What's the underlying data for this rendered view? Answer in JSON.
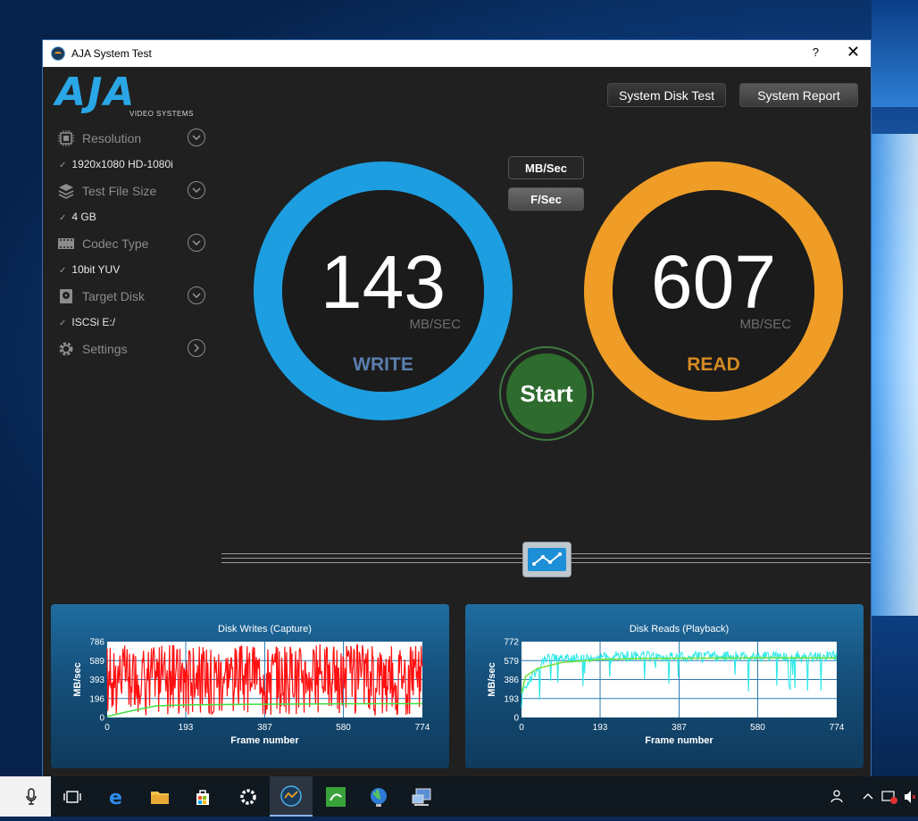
{
  "window": {
    "title": "AJA System Test",
    "help": "?",
    "close": "✕"
  },
  "logo": {
    "main": "AJA",
    "sub": "VIDEO SYSTEMS"
  },
  "top_buttons": {
    "disk_test": "System Disk Test",
    "report": "System Report"
  },
  "sidebar": {
    "resolution": {
      "label": "Resolution",
      "value": "1920x1080 HD-1080i"
    },
    "file_size": {
      "label": "Test File Size",
      "value": "4 GB"
    },
    "codec": {
      "label": "Codec Type",
      "value": "10bit YUV"
    },
    "target": {
      "label": "Target Disk",
      "value": "ISCSi E:/"
    },
    "settings": {
      "label": "Settings"
    },
    "check": "✓"
  },
  "units": {
    "mbsec": "MB/Sec",
    "fsec": "F/Sec"
  },
  "write": {
    "value": "143",
    "unit": "MB/SEC",
    "label": "WRITE",
    "color": "#1d9ee0"
  },
  "read": {
    "value": "607",
    "unit": "MB/SEC",
    "label": "READ",
    "color": "#ef9d27"
  },
  "start_label": "Start",
  "chart_data": [
    {
      "type": "line",
      "title": "Disk Writes (Capture)",
      "xlabel": "Frame number",
      "ylabel": "MB/sec",
      "xticks": [
        0,
        193,
        387,
        580,
        774
      ],
      "yticks": [
        0,
        196,
        393,
        589,
        786
      ],
      "xlim": [
        0,
        774
      ],
      "ylim": [
        0,
        786
      ],
      "grid": true,
      "series": [
        {
          "color": "#ff1010",
          "approx_range": [
            20,
            786
          ],
          "typical": 400
        },
        {
          "color": "#40e040",
          "x": [
            0,
            50,
            120,
            193,
            300,
            387,
            500,
            580,
            700,
            774
          ],
          "values": [
            10,
            60,
            120,
            130,
            135,
            138,
            140,
            142,
            143,
            143
          ]
        }
      ]
    },
    {
      "type": "line",
      "title": "Disk Reads (Playback)",
      "xlabel": "Frame number",
      "ylabel": "MB/sec",
      "xticks": [
        0,
        193,
        387,
        580,
        774
      ],
      "yticks": [
        0,
        193,
        386,
        579,
        772
      ],
      "xlim": [
        0,
        774
      ],
      "ylim": [
        0,
        772
      ],
      "grid": true,
      "series": [
        {
          "color": "#30e8e8",
          "typical": 620,
          "approx_range": [
            100,
            772
          ]
        },
        {
          "color": "#70e030",
          "x": [
            0,
            10,
            40,
            100,
            193,
            300,
            387,
            500,
            580,
            700,
            774
          ],
          "values": [
            250,
            420,
            500,
            560,
            590,
            600,
            603,
            605,
            606,
            607,
            607
          ]
        }
      ]
    }
  ],
  "taskbar": {
    "icons": [
      "microphone-icon",
      "task-view-icon",
      "edge-icon",
      "file-explorer-icon",
      "store-icon",
      "settings-icon",
      "aja-system-test-icon",
      "app-green-icon",
      "globe-icon",
      "network-icon"
    ]
  }
}
